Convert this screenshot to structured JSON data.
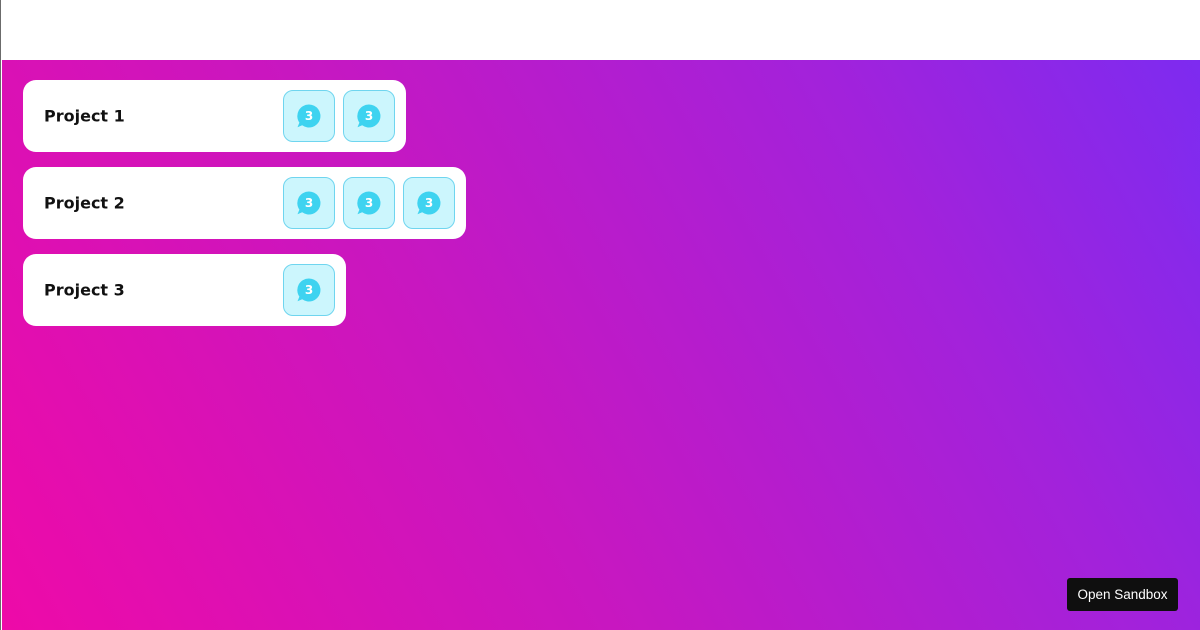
{
  "projects": [
    {
      "name": "Project 1",
      "items": [
        {
          "badge": "3",
          "icon": "chat-bubble-icon"
        },
        {
          "badge": "3",
          "icon": "chat-bubble-icon"
        }
      ]
    },
    {
      "name": "Project 2",
      "items": [
        {
          "badge": "3",
          "icon": "chat-bubble-icon"
        },
        {
          "badge": "3",
          "icon": "chat-bubble-icon"
        },
        {
          "badge": "3",
          "icon": "chat-bubble-icon"
        }
      ]
    },
    {
      "name": "Project 3",
      "items": [
        {
          "badge": "3",
          "icon": "chat-bubble-icon"
        }
      ]
    }
  ],
  "open_sandbox_label": "Open Sandbox",
  "colors": {
    "gradient_start": "#ee0aa8",
    "gradient_end": "#7d2bf0",
    "tile_bg": "#ccf6fd",
    "tile_border": "#6fd5ef",
    "icon_fill": "#3ed3f0",
    "button_bg": "#0f0f0f"
  }
}
